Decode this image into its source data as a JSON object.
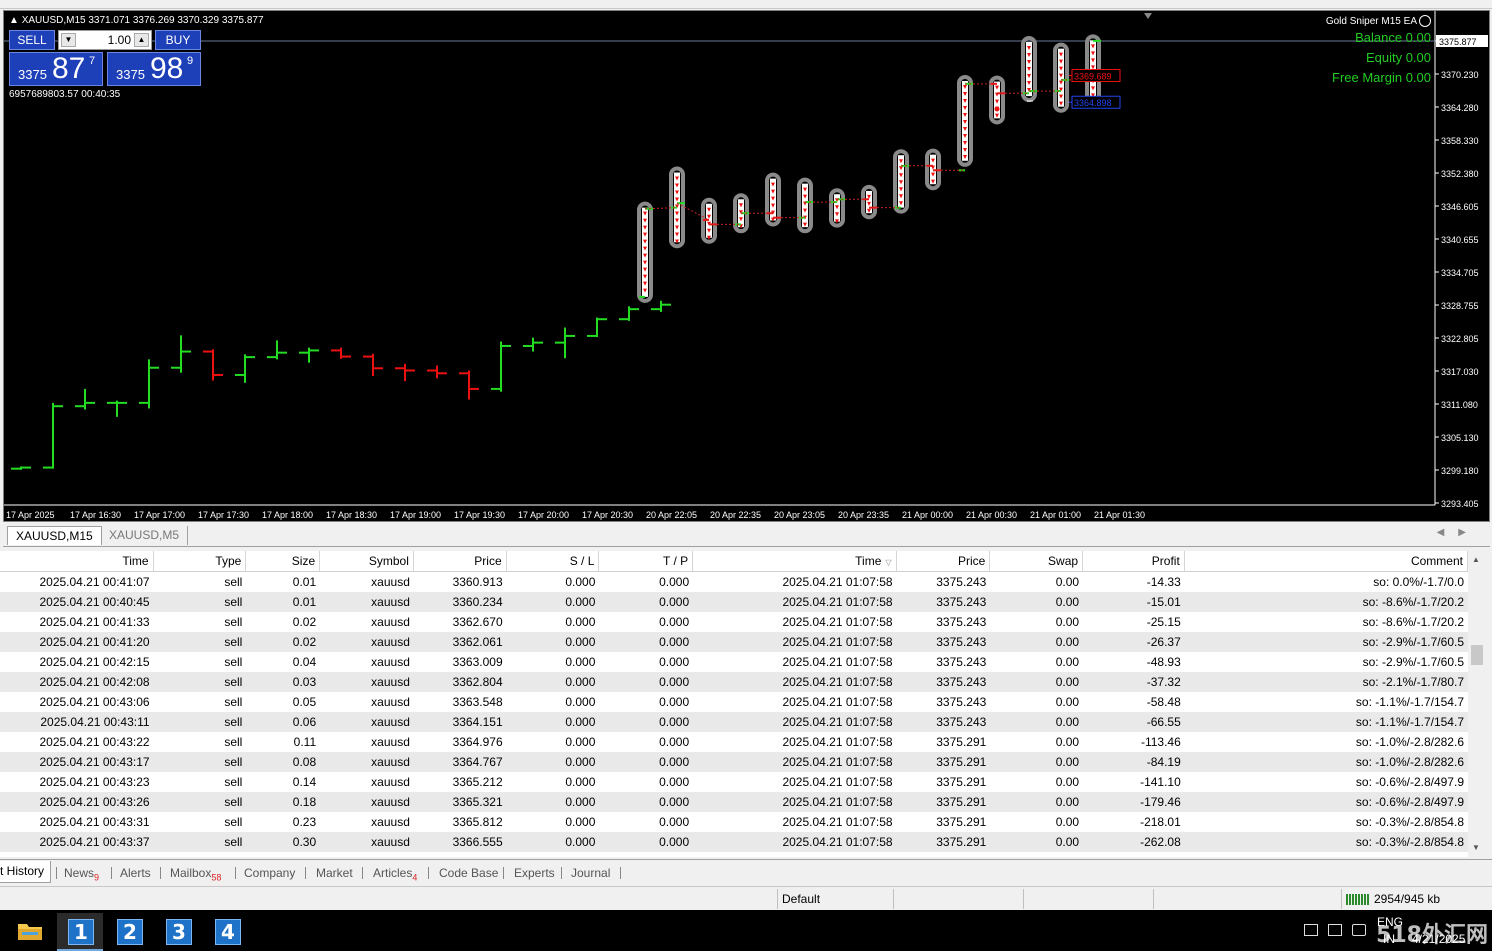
{
  "chart": {
    "symbol_header": "XAUUSD,M15  3371.071 3376.269 3370.329 3375.877",
    "one_click": {
      "sell_label": "SELL",
      "buy_label": "BUY",
      "lot": "1.00",
      "sell_small": "3375",
      "sell_big": "87",
      "sell_sup": "7",
      "buy_small": "3375",
      "buy_big": "98",
      "buy_sup": "9",
      "info": "6957689803.57 00:40:35"
    },
    "ea_name": "Gold Sniper M15 EA",
    "account": {
      "balance": "Balance 0.00",
      "equity": "Equity 0.00",
      "free_margin": "Free Margin 0.00"
    },
    "price_axis": [
      "3375.877",
      "3370.230",
      "3364.280",
      "3358.330",
      "3352.380",
      "3346.605",
      "3340.655",
      "3334.705",
      "3328.755",
      "3322.805",
      "3317.030",
      "3311.080",
      "3305.130",
      "3299.180",
      "3293.405"
    ],
    "current_price": "3375.877",
    "time_axis": [
      "17 Apr 2025",
      "17 Apr 16:30",
      "17 Apr 17:00",
      "17 Apr 17:30",
      "17 Apr 18:00",
      "17 Apr 18:30",
      "17 Apr 19:00",
      "17 Apr 19:30",
      "17 Apr 20:00",
      "17 Apr 20:30",
      "20 Apr 22:05",
      "20 Apr 22:35",
      "20 Apr 23:05",
      "20 Apr 23:35",
      "21 Apr 00:00",
      "21 Apr 00:30",
      "21 Apr 01:00",
      "21 Apr 01:30"
    ],
    "order_labels": {
      "red": "3369.689",
      "blue": "3364.898"
    },
    "colors": {
      "bull": "#22dd22",
      "bear": "#ee1111",
      "background": "#000000",
      "grid_text": "#ffffff"
    }
  },
  "chart_tabs": [
    "XAUUSD,M15",
    "XAUUSD,M5"
  ],
  "grid": {
    "headers": [
      "Time",
      "Type",
      "Size",
      "Symbol",
      "Price",
      "S / L",
      "T / P",
      "Time",
      "Price",
      "Swap",
      "Profit",
      "Comment"
    ],
    "rows": [
      [
        "2025.04.21 00:41:07",
        "sell",
        "0.01",
        "xauusd",
        "3360.913",
        "0.000",
        "0.000",
        "2025.04.21 01:07:58",
        "3375.243",
        "0.00",
        "-14.33",
        "so: 0.0%/-1.7/0.0"
      ],
      [
        "2025.04.21 00:40:45",
        "sell",
        "0.01",
        "xauusd",
        "3360.234",
        "0.000",
        "0.000",
        "2025.04.21 01:07:58",
        "3375.243",
        "0.00",
        "-15.01",
        "so: -8.6%/-1.7/20.2"
      ],
      [
        "2025.04.21 00:41:33",
        "sell",
        "0.02",
        "xauusd",
        "3362.670",
        "0.000",
        "0.000",
        "2025.04.21 01:07:58",
        "3375.243",
        "0.00",
        "-25.15",
        "so: -8.6%/-1.7/20.2"
      ],
      [
        "2025.04.21 00:41:20",
        "sell",
        "0.02",
        "xauusd",
        "3362.061",
        "0.000",
        "0.000",
        "2025.04.21 01:07:58",
        "3375.243",
        "0.00",
        "-26.37",
        "so: -2.9%/-1.7/60.5"
      ],
      [
        "2025.04.21 00:42:15",
        "sell",
        "0.04",
        "xauusd",
        "3363.009",
        "0.000",
        "0.000",
        "2025.04.21 01:07:58",
        "3375.243",
        "0.00",
        "-48.93",
        "so: -2.9%/-1.7/60.5"
      ],
      [
        "2025.04.21 00:42:08",
        "sell",
        "0.03",
        "xauusd",
        "3362.804",
        "0.000",
        "0.000",
        "2025.04.21 01:07:58",
        "3375.243",
        "0.00",
        "-37.32",
        "so: -2.1%/-1.7/80.7"
      ],
      [
        "2025.04.21 00:43:06",
        "sell",
        "0.05",
        "xauusd",
        "3363.548",
        "0.000",
        "0.000",
        "2025.04.21 01:07:58",
        "3375.243",
        "0.00",
        "-58.48",
        "so: -1.1%/-1.7/154.7"
      ],
      [
        "2025.04.21 00:43:11",
        "sell",
        "0.06",
        "xauusd",
        "3364.151",
        "0.000",
        "0.000",
        "2025.04.21 01:07:58",
        "3375.243",
        "0.00",
        "-66.55",
        "so: -1.1%/-1.7/154.7"
      ],
      [
        "2025.04.21 00:43:22",
        "sell",
        "0.11",
        "xauusd",
        "3364.976",
        "0.000",
        "0.000",
        "2025.04.21 01:07:58",
        "3375.291",
        "0.00",
        "-113.46",
        "so: -1.0%/-2.8/282.6"
      ],
      [
        "2025.04.21 00:43:17",
        "sell",
        "0.08",
        "xauusd",
        "3364.767",
        "0.000",
        "0.000",
        "2025.04.21 01:07:58",
        "3375.291",
        "0.00",
        "-84.19",
        "so: -1.0%/-2.8/282.6"
      ],
      [
        "2025.04.21 00:43:23",
        "sell",
        "0.14",
        "xauusd",
        "3365.212",
        "0.000",
        "0.000",
        "2025.04.21 01:07:58",
        "3375.291",
        "0.00",
        "-141.10",
        "so: -0.6%/-2.8/497.9"
      ],
      [
        "2025.04.21 00:43:26",
        "sell",
        "0.18",
        "xauusd",
        "3365.321",
        "0.000",
        "0.000",
        "2025.04.21 01:07:58",
        "3375.291",
        "0.00",
        "-179.46",
        "so: -0.6%/-2.8/497.9"
      ],
      [
        "2025.04.21 00:43:31",
        "sell",
        "0.23",
        "xauusd",
        "3365.812",
        "0.000",
        "0.000",
        "2025.04.21 01:07:58",
        "3375.291",
        "0.00",
        "-218.01",
        "so: -0.3%/-2.8/854.8"
      ],
      [
        "2025.04.21 00:43:37",
        "sell",
        "0.30",
        "xauusd",
        "3366.555",
        "0.000",
        "0.000",
        "2025.04.21 01:07:58",
        "3375.291",
        "0.00",
        "-262.08",
        "so: -0.3%/-2.8/854.8"
      ]
    ]
  },
  "bottom_tabs": [
    {
      "label": "t History",
      "badge": ""
    },
    {
      "label": "News",
      "badge": "9"
    },
    {
      "label": "Alerts",
      "badge": ""
    },
    {
      "label": "Mailbox",
      "badge": "58"
    },
    {
      "label": "Company",
      "badge": ""
    },
    {
      "label": "Market",
      "badge": ""
    },
    {
      "label": "Articles",
      "badge": "4"
    },
    {
      "label": "Code Base",
      "badge": ""
    },
    {
      "label": "Experts",
      "badge": ""
    },
    {
      "label": "Journal",
      "badge": ""
    }
  ],
  "status": {
    "profile": "Default",
    "traffic": "2954/945 kb"
  },
  "taskbar": {
    "buttons": [
      "1",
      "2",
      "3",
      "4"
    ],
    "lang_top": "ENG",
    "lang_bottom": "IN",
    "date": "4/21/2025"
  },
  "watermark": "518外汇网"
}
